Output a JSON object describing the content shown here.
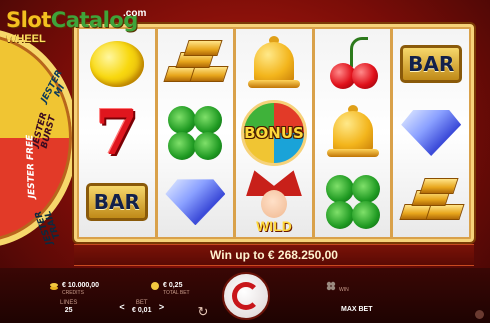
{
  "logo": {
    "part1": "Slot",
    "part2": "Catalog",
    "suffix": ".com"
  },
  "wheel": {
    "title": "WHEEL",
    "segments": [
      "JESTER MI",
      "JESTER BURST",
      "JESTER FREE",
      "JESTER TRAIL"
    ]
  },
  "reels": [
    [
      "lemon",
      "seven",
      "bar"
    ],
    [
      "gold",
      "clover",
      "diamond"
    ],
    [
      "bell",
      "bonus",
      "joker-wild"
    ],
    [
      "cherry",
      "bell",
      "clover"
    ],
    [
      "bar",
      "diamond",
      "gold"
    ]
  ],
  "symbols": {
    "bar": "BAR",
    "bonus": "BONUS",
    "wild": "WILD"
  },
  "win_banner": "Win up to € 268.250,00",
  "stats": {
    "credits": {
      "value": "€ 10.000,00",
      "label": "CREDITS"
    },
    "total_bet": {
      "value": "€ 0,25",
      "label": "TOTAL BET"
    },
    "win": {
      "value": "",
      "label": "WIN"
    }
  },
  "lines": {
    "label": "LINES",
    "value": "25"
  },
  "bet": {
    "label": "BET",
    "value": "€ 0,01",
    "decrease": "<",
    "increase": ">"
  },
  "autoplay_icon": "↻",
  "max_bet": "MAX BET",
  "colors": {
    "accent_red": "#c8161a",
    "gold": "#f6d27a",
    "background": "#7a0d08"
  }
}
